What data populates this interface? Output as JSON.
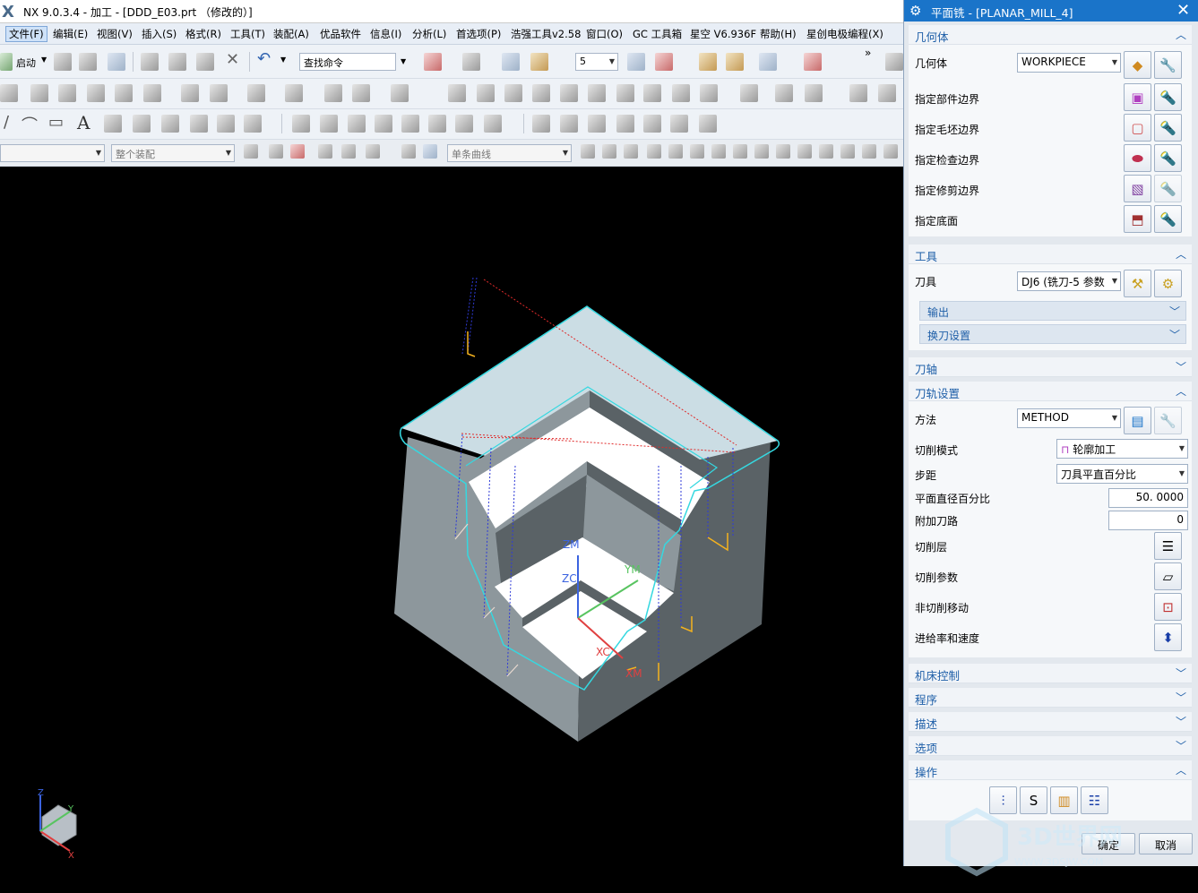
{
  "window": {
    "title": "NX 9.0.3.4 - 加工 - [DDD_E03.prt （修改的）]",
    "logo": "X"
  },
  "menu": [
    "文件(F)",
    "编辑(E)",
    "视图(V)",
    "插入(S)",
    "格式(R)",
    "工具(T)",
    "装配(A)",
    "优品软件",
    "信息(I)",
    "分析(L)",
    "首选项(P)",
    "浩强工具v2.58",
    "窗口(O)",
    "GC 工具箱",
    "星空 V6.936F",
    "帮助(H)",
    "星创电极编程(X)"
  ],
  "toolbar": {
    "start_label": "启动",
    "find_command": "查找命令",
    "number_value": "5",
    "filter_assembly": "整个装配",
    "curve_rule": "单条曲线"
  },
  "panel": {
    "title": "平面铣 - [PLANAR_MILL_4]",
    "geometry": {
      "header": "几何体",
      "geometry_label": "几何体",
      "geometry_value": "WORKPIECE",
      "rows": [
        "指定部件边界",
        "指定毛坯边界",
        "指定检查边界",
        "指定修剪边界",
        "指定底面"
      ]
    },
    "tool": {
      "header": "工具",
      "tool_label": "刀具",
      "tool_value": "DJ6 (铣刀-5 参数",
      "output": "输出",
      "tool_change": "换刀设置"
    },
    "tool_axis": {
      "header": "刀轴"
    },
    "path_settings": {
      "header": "刀轨设置",
      "method_label": "方法",
      "method_value": "METHOD",
      "cut_pattern_label": "切削模式",
      "cut_pattern_value": "轮廓加工",
      "stepover_label": "步距",
      "stepover_value": "刀具平直百分比",
      "flat_diameter_label": "平面直径百分比",
      "flat_diameter_value": "50. 0000",
      "additional_passes_label": "附加刀路",
      "additional_passes_value": "0",
      "cut_levels_label": "切削层",
      "cut_params_label": "切削参数",
      "non_cut_label": "非切削移动",
      "feeds_label": "进给率和速度"
    },
    "machine_control": "机床控制",
    "program": "程序",
    "description": "描述",
    "options": "选项",
    "actions": "操作",
    "ok": "确定",
    "cancel": "取消"
  },
  "viewport": {
    "axis_labels": {
      "zm": "ZM",
      "zc": "ZC",
      "ym": "YM",
      "xc": "XC",
      "xm": "XM"
    },
    "triad": {
      "z": "Z",
      "y": "Y",
      "x": "X"
    }
  },
  "watermark": {
    "text": "3D世界网",
    "url": "WWW.3DSJW.COM"
  }
}
